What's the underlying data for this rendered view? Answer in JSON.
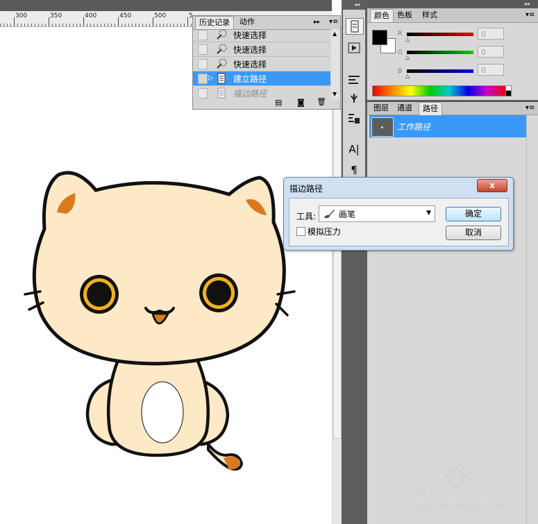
{
  "ruler": {
    "labels": [
      "300",
      "350",
      "400",
      "450",
      "500",
      "5"
    ]
  },
  "history_panel": {
    "tabs": [
      "历史记录",
      "动作"
    ],
    "items": [
      {
        "label": "快速选择",
        "state": "normal"
      },
      {
        "label": "快速选择",
        "state": "normal"
      },
      {
        "label": "快速选择",
        "state": "normal"
      },
      {
        "label": "建立路径",
        "state": "selected"
      },
      {
        "label": "描边路径",
        "state": "dimmed"
      }
    ]
  },
  "color_panel": {
    "tabs": [
      "颜色",
      "色板",
      "样式"
    ],
    "channels": [
      {
        "name": "R",
        "value": "0"
      },
      {
        "name": "G",
        "value": "0"
      },
      {
        "name": "B",
        "value": "0"
      }
    ],
    "foreground": "#000000",
    "background": "#ffffff"
  },
  "paths_panel": {
    "tabs": [
      "图层",
      "通道",
      "路径"
    ],
    "items": [
      {
        "label": "工作路径"
      }
    ]
  },
  "dialog": {
    "title": "描边路径",
    "tool_label": "工具:",
    "tool_value": "画笔",
    "simulate_pressure": "模拟压力",
    "ok": "确定",
    "cancel": "取消",
    "close": "x"
  },
  "watermark": {
    "brand": "Baidu经验",
    "url": "jingyan.baidu.com"
  },
  "colors": {
    "selection": "#3a99f6",
    "cat_body": "#fde9c6",
    "cat_ear": "#d97a1e",
    "cat_eye_ring": "#f0b21b"
  }
}
